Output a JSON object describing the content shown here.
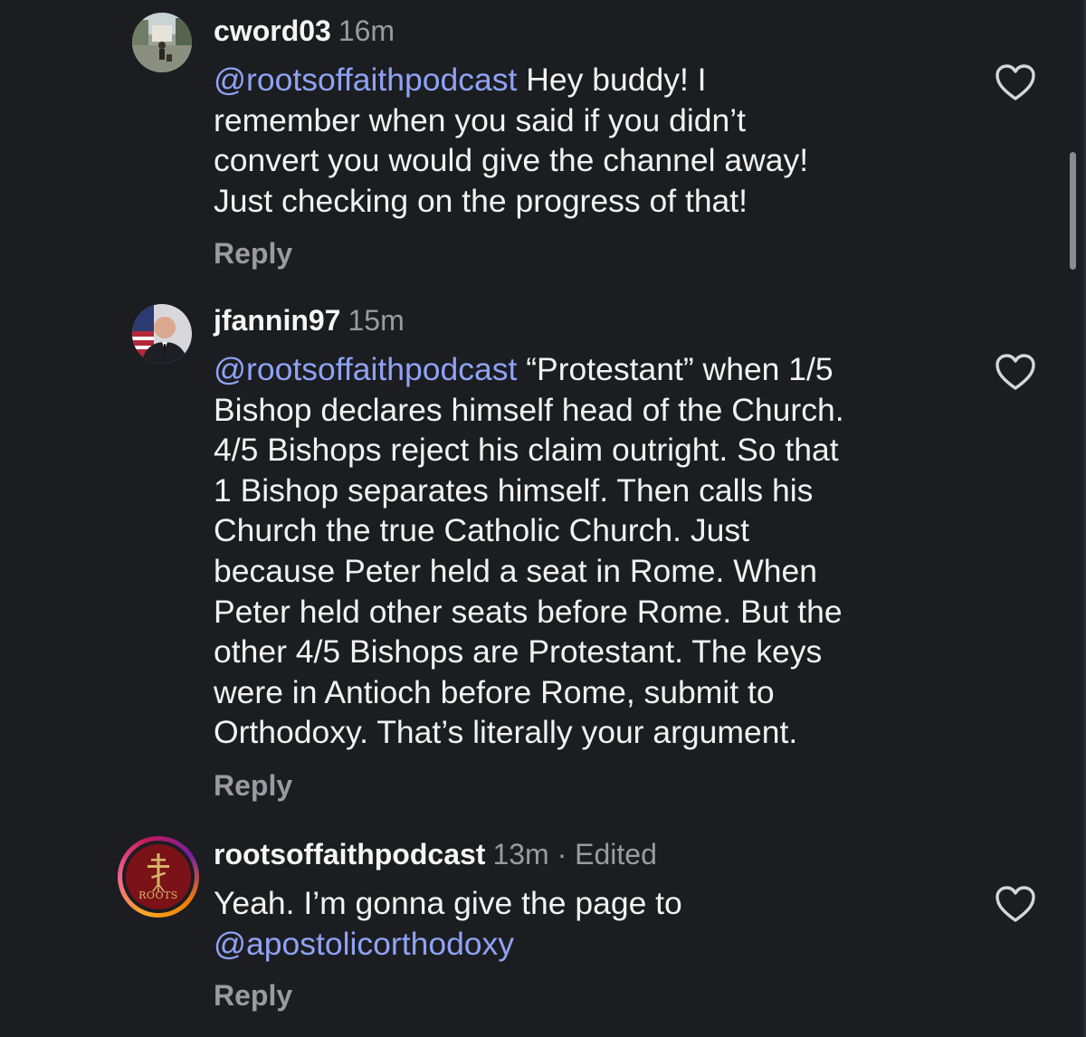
{
  "comments": [
    {
      "username": "cword03",
      "meta": "16m",
      "mention": "@rootsoffaithpodcast",
      "text_lines": [
        " Hey buddy! I",
        "remember when you said if you didn’t",
        "convert you would give the channel away!",
        "Just checking on the progress of that!"
      ],
      "reply_label": "Reply",
      "like_icon": "heart-outline-icon"
    },
    {
      "username": "jfannin97",
      "meta": "15m",
      "mention": "@rootsoffaithpodcast",
      "text_lines": [
        " “Protestant” when 1/5",
        "Bishop declares himself head of the Church.",
        "4/5 Bishops reject his claim outright. So that",
        "1 Bishop separates himself. Then calls his",
        "Church the true Catholic Church. Just",
        "because Peter held a seat in Rome. When",
        "Peter held other seats before Rome. But the",
        "other 4/5 Bishops are Protestant. The keys",
        "were in Antioch before Rome, submit to",
        "Orthodoxy. That’s literally your argument."
      ],
      "reply_label": "Reply",
      "like_icon": "heart-outline-icon"
    },
    {
      "username": "rootsoffaithpodcast",
      "meta": "13m · Edited",
      "text_line1": "Yeah. I’m gonna give the page to",
      "mention": "@apostolicorthodoxy",
      "reply_label": "Reply",
      "like_icon": "heart-outline-icon",
      "avatar_text": "ROOTS"
    }
  ],
  "colors": {
    "background": "#1c1d21",
    "mention": "#8fa3f5",
    "secondary_text": "#9a9a9f"
  }
}
